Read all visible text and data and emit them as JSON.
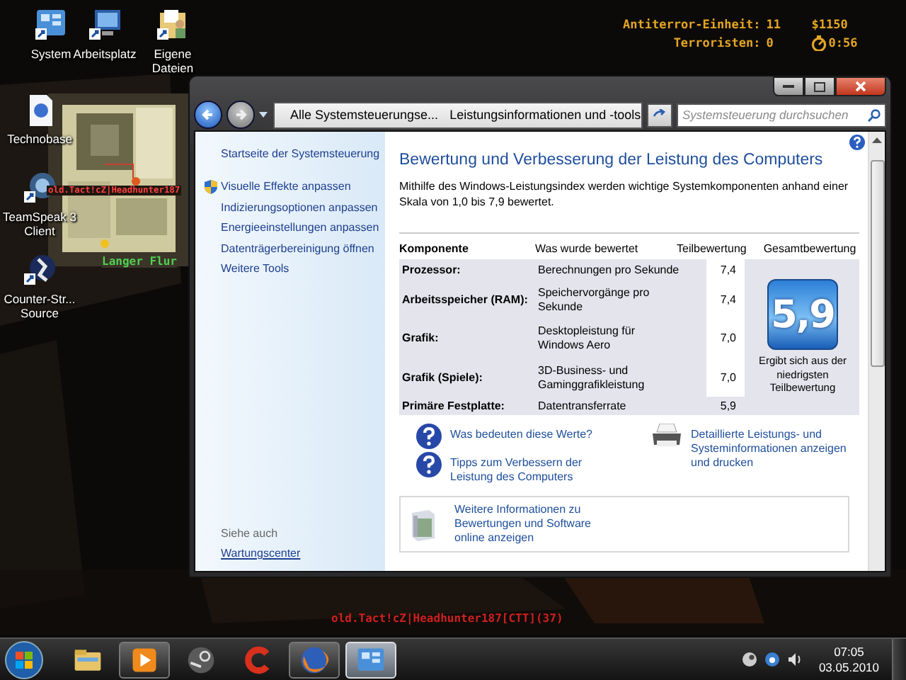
{
  "desktop": {
    "icons": [
      {
        "label": "System",
        "kind": "system"
      },
      {
        "label": "Arbeitsplatz",
        "kind": "computer"
      },
      {
        "label": "Eigene Dateien",
        "kind": "documents"
      },
      {
        "label": "Technobase",
        "kind": "file"
      },
      {
        "label": "TeamSpeak 3 Client",
        "kind": "teamspeak"
      },
      {
        "label": "Counter-Str... Source",
        "kind": "game"
      }
    ]
  },
  "hud": {
    "ct_label": "Antiterror-Einheit:",
    "ct_score": "11",
    "money": "$1150",
    "t_label": "Terroristen:",
    "t_score": "0",
    "timer": "0:56"
  },
  "game_overlay": {
    "player_tag": "old.Tact!cZ|Headhunter187",
    "location": "Langer Flur",
    "chat_line": "old.Tact!cZ|Headhunter187[CTT](37)"
  },
  "window": {
    "breadcrumbs": [
      "Alle Systemsteuerungse...",
      "Leistungsinformationen und -tools"
    ],
    "search": {
      "placeholder": "Systemsteuerung durchsuchen"
    },
    "sidebar": {
      "links": [
        {
          "label": "Startseite der Systemsteuerung",
          "kind": "home"
        },
        {
          "label": "Visuelle Effekte anpassen",
          "kind": "shield"
        },
        {
          "label": "Indizierungsoptionen anpassen",
          "kind": "plain"
        },
        {
          "label": "Energieeinstellungen anpassen",
          "kind": "plain"
        },
        {
          "label": "Datenträgerbereinigung öffnen",
          "kind": "plain"
        },
        {
          "label": "Weitere Tools",
          "kind": "plain"
        }
      ],
      "see_also_title": "Siehe auch",
      "see_also": [
        "Wartungscenter"
      ]
    },
    "heading": "Bewertung und Verbesserung der Leistung des Computers",
    "description": "Mithilfe des Windows-Leistungsindex werden wichtige Systemkomponenten anhand einer Skala von 1,0 bis 7,9 bewertet.",
    "table": {
      "columns": [
        "Komponente",
        "Was wurde bewertet",
        "Teilbewertung",
        "Gesamtbewertung"
      ],
      "rows": [
        {
          "component": "Prozessor:",
          "measured": "Berechnungen pro Sekunde",
          "score": "7,4",
          "lowest": false
        },
        {
          "component": "Arbeitsspeicher (RAM):",
          "measured": "Speichervorgänge pro Sekunde",
          "score": "7,4",
          "lowest": false
        },
        {
          "component": "Grafik:",
          "measured": "Desktopleistung für Windows Aero",
          "score": "7,0",
          "lowest": false
        },
        {
          "component": "Grafik (Spiele):",
          "measured": "3D-Business- und Gaminggrafikleistung",
          "score": "7,0",
          "lowest": false
        },
        {
          "component": "Primäre Festplatte:",
          "measured": "Datentransferrate",
          "score": "5,9",
          "lowest": true
        }
      ],
      "base_score": "5,9",
      "base_score_note": "Ergibt sich aus der niedrigsten Teilbewertung"
    },
    "links": [
      {
        "label": "Was bedeuten diese Werte?",
        "kind": "help"
      },
      {
        "label": "Tipps zum Verbessern der Leistung des Computers",
        "kind": "help"
      },
      {
        "label": "Detaillierte Leistungs- und Systeminformationen anzeigen und drucken",
        "kind": "print"
      }
    ],
    "online_box": {
      "label": "Weitere Informationen zu Bewertungen und Software online anzeigen"
    }
  },
  "taskbar": {
    "items": [
      {
        "kind": "explorer",
        "running": false,
        "selected": false
      },
      {
        "kind": "media",
        "running": true,
        "selected": false
      },
      {
        "kind": "steam",
        "running": false,
        "selected": false
      },
      {
        "kind": "ccleaner",
        "running": false,
        "selected": false
      },
      {
        "kind": "firefox",
        "running": true,
        "selected": false
      },
      {
        "kind": "control_panel",
        "running": true,
        "selected": true
      }
    ],
    "clock": {
      "time": "07:05",
      "date": "03.05.2010"
    }
  }
}
